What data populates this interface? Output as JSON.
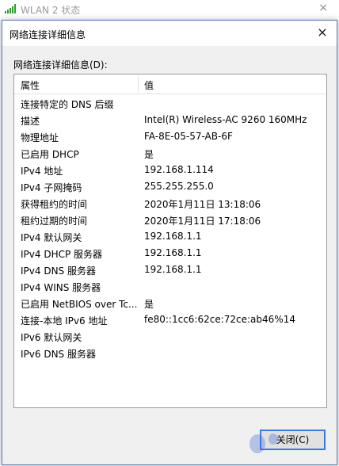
{
  "background_window": {
    "title": "WLAN 2 状态",
    "close_glyph": "×"
  },
  "dialog": {
    "title": "网络连接详细信息",
    "close_glyph": "×",
    "group_label": "网络连接详细信息(D):",
    "columns": [
      "属性",
      "值"
    ],
    "rows": [
      {
        "key": "连接特定的 DNS 后缀",
        "value": ""
      },
      {
        "key": "描述",
        "value": "Intel(R) Wireless-AC 9260 160MHz"
      },
      {
        "key": "物理地址",
        "value": "FA-8E-05-57-AB-6F"
      },
      {
        "key": "已启用 DHCP",
        "value": "是"
      },
      {
        "key": "IPv4 地址",
        "value": "192.168.1.114"
      },
      {
        "key": "IPv4 子网掩码",
        "value": "255.255.255.0"
      },
      {
        "key": "获得租约的时间",
        "value": "2020年1月11日 13:18:06"
      },
      {
        "key": "租约过期的时间",
        "value": "2020年1月11日 17:18:06"
      },
      {
        "key": "IPv4 默认网关",
        "value": "192.168.1.1"
      },
      {
        "key": "IPv4 DHCP 服务器",
        "value": "192.168.1.1"
      },
      {
        "key": "IPv4 DNS 服务器",
        "value": "192.168.1.1"
      },
      {
        "key": "IPv4 WINS 服务器",
        "value": ""
      },
      {
        "key": "已启用 NetBIOS over Tc...",
        "value": "是"
      },
      {
        "key": "连接-本地 IPv6 地址",
        "value": "fe80::1cc6:62ce:72ce:ab46%14"
      },
      {
        "key": "IPv6 默认网关",
        "value": ""
      },
      {
        "key": "IPv6 DNS 服务器",
        "value": ""
      }
    ],
    "close_button_label": "关闭(C)"
  },
  "colors": {
    "accent_border": "#3b79d8",
    "signal_green": "#2e9d2e"
  },
  "icons": {
    "signal": "wifi-signal-icon",
    "close": "close-icon"
  }
}
